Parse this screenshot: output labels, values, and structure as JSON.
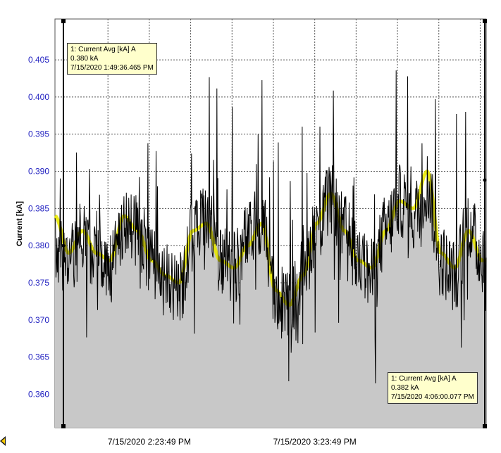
{
  "chart_data": {
    "type": "line",
    "ylabel": "Current [kA]",
    "ylim": [
      0.3555,
      0.4105
    ],
    "yticks": [
      0.36,
      0.365,
      0.37,
      0.375,
      0.38,
      0.385,
      0.39,
      0.395,
      0.4,
      0.405
    ],
    "ytick_labels": [
      "0.360",
      "0.365",
      "0.370",
      "0.375",
      "0.380",
      "0.385",
      "0.390",
      "0.395",
      "0.400",
      "0.405"
    ],
    "xlim_seconds_from_1_49_36": [
      0,
      9384
    ],
    "xtick_labels": [
      "7/15/2020 2:23:49 PM",
      "7/15/2020 3:23:49 PM"
    ],
    "xticks_seconds_from_1_49_36": [
      2053,
      5653
    ],
    "grid": true,
    "series": [
      {
        "color": "#000000",
        "x": [
          0,
          300,
          600,
          900,
          1200,
          1500,
          1800,
          2100,
          2400,
          2700,
          3000,
          3300,
          3600,
          3900,
          4200,
          4500,
          4800,
          5100,
          5400,
          5700,
          6000,
          6300,
          6600,
          6900,
          7200,
          7500,
          7800,
          8100,
          8400,
          8700,
          9000,
          9300
        ],
        "y": [
          0.38,
          0.378,
          0.381,
          0.379,
          0.377,
          0.383,
          0.382,
          0.378,
          0.376,
          0.374,
          0.381,
          0.384,
          0.378,
          0.377,
          0.381,
          0.384,
          0.373,
          0.372,
          0.376,
          0.383,
          0.386,
          0.382,
          0.378,
          0.376,
          0.382,
          0.386,
          0.384,
          0.388,
          0.378,
          0.376,
          0.383,
          0.378
        ]
      },
      {
        "color": "#e8e800",
        "x": [
          0,
          300,
          600,
          900,
          1200,
          1500,
          1800,
          2100,
          2400,
          2700,
          3000,
          3300,
          3600,
          3900,
          4200,
          4500,
          4800,
          5100,
          5400,
          5700,
          6000,
          6300,
          6600,
          6900,
          7200,
          7500,
          7800,
          8100,
          8400,
          8700,
          9000,
          9300
        ],
        "y": [
          0.384,
          0.379,
          0.382,
          0.379,
          0.378,
          0.384,
          0.382,
          0.378,
          0.376,
          0.375,
          0.382,
          0.383,
          0.378,
          0.377,
          0.38,
          0.383,
          0.374,
          0.372,
          0.376,
          0.383,
          0.387,
          0.382,
          0.378,
          0.377,
          0.382,
          0.386,
          0.385,
          0.39,
          0.379,
          0.377,
          0.382,
          0.378
        ]
      }
    ],
    "annotations": [
      {
        "series_label": "1: Current Avg [kA] A",
        "value_label": "0.380 kA",
        "time_label": "7/15/2020 1:49:36.465 PM",
        "x": 0,
        "y": 0.38
      },
      {
        "series_label": "1: Current Avg [kA] A",
        "value_label": "0.382 kA",
        "time_label": "7/15/2020 4:06:00.077 PM",
        "x": 8184,
        "y": 0.382
      }
    ]
  },
  "colors": {
    "plot_fill": "#c8c8c8",
    "raw_line": "#000000",
    "average_line": "#e8e800",
    "tick_text": "#2020c0"
  },
  "icons": {
    "scroll_left": "triangle-left-icon"
  }
}
